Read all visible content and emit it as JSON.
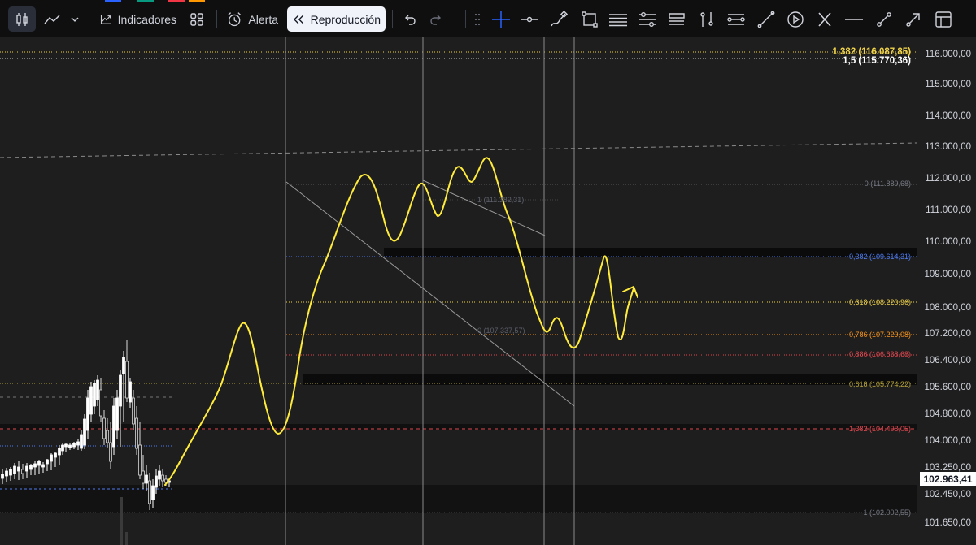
{
  "toolbar": {
    "indicators_label": "Indicadores",
    "alert_label": "Alerta",
    "replay_label": "Reproducción",
    "accent_colors": [
      "#2962ff",
      "#089981",
      "#f23645",
      "#ff9800"
    ],
    "icons": [
      "candles-icon",
      "line-chart-icon",
      "chevron-down-icon",
      "indicators-icon",
      "templates-icon",
      "alarm-clock-icon",
      "replay-icon",
      "undo-icon",
      "redo-icon",
      "drag-handle-icon",
      "crosshair-icon",
      "horizontal-ray-icon",
      "brush-icon",
      "rectangle-icon",
      "text-lines-icon",
      "fib-levels-icon",
      "fib-channel-icon",
      "vertical-bars-icon",
      "projection-icon",
      "ruler-icon",
      "play-circle-icon",
      "x-pattern-icon",
      "horizontal-line-icon",
      "trend-line-icon",
      "arrow-up-right-icon",
      "layout-icon"
    ]
  },
  "price_axis": {
    "labels": [
      "116.000,00",
      "115.000,00",
      "114.000,00",
      "113.000,00",
      "112.000,00",
      "111.000,00",
      "110.000,00",
      "109.000,00",
      "108.000,00",
      "107.200,00",
      "106.400,00",
      "105.600,00",
      "104.800,00",
      "104.000,00",
      "103.250,00",
      "102.450,00",
      "101.650,00"
    ],
    "current_price": "102.963,41"
  },
  "top_fib_labels": [
    {
      "text": "1,382 (116.087,85)",
      "color": "#f0d34a"
    },
    {
      "text": "1,5 (115.770,36)",
      "color": "#ffffff"
    }
  ],
  "fib_labels": [
    {
      "text": "0 (111.889,68)",
      "color": "#787b86"
    },
    {
      "text": "1 (111.382,31)",
      "color": "#5d606b"
    },
    {
      "text": "0,382 (109.614,31)",
      "color": "#4d7bf3"
    },
    {
      "text": "0,618 (108.220,96)",
      "color": "#f0d34a"
    },
    {
      "text": "0 (107.337,57)",
      "color": "#5d606b"
    },
    {
      "text": "0,786 (107.229,08)",
      "color": "#f7931a"
    },
    {
      "text": "0,886 (106.638,68)",
      "color": "#e0474f"
    },
    {
      "text": "0,618 (105.774,22)",
      "color": "#b5a33a"
    },
    {
      "text": "1,382 (104.408,05)",
      "color": "#e0474f"
    },
    {
      "text": "1 (102.002,55)",
      "color": "#787b86"
    }
  ],
  "drawing_colors": {
    "projection_path": "#ffeb3b",
    "bullish_candle": "#ffffff",
    "bearish_candle": "#d9d9d9",
    "background": "#1e1e1e"
  }
}
